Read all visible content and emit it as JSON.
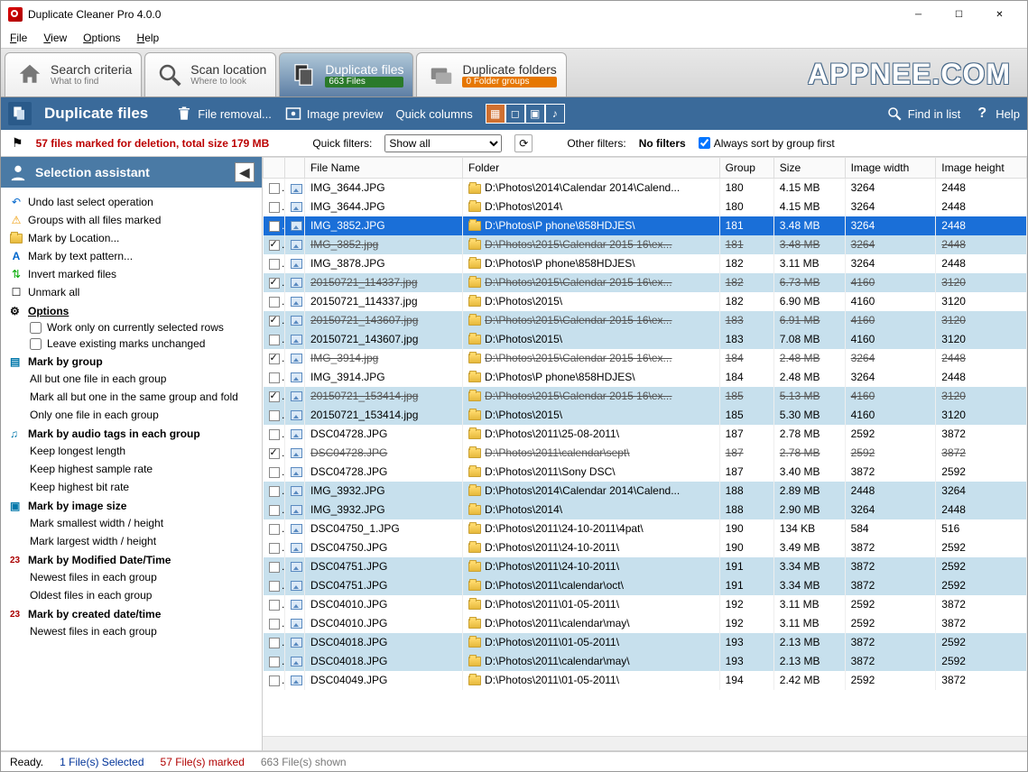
{
  "window": {
    "title": "Duplicate Cleaner Pro 4.0.0"
  },
  "menu": {
    "file": "File",
    "view": "View",
    "options": "Options",
    "help": "Help"
  },
  "tabs": {
    "search": {
      "title": "Search criteria",
      "sub": "What to find"
    },
    "scan": {
      "title": "Scan location",
      "sub": "Where to look"
    },
    "files": {
      "title": "Duplicate files",
      "badge": "663 Files"
    },
    "folders": {
      "title": "Duplicate folders",
      "badge": "0 Folder groups"
    }
  },
  "watermark": "APPNEE.COM",
  "ribbon": {
    "title": "Duplicate files",
    "fileremoval": "File removal...",
    "imagepreview": "Image preview",
    "quickcols": "Quick columns",
    "findinlist": "Find in list",
    "help": "Help"
  },
  "filterbar": {
    "marked": "57 files marked for deletion, total size 179 MB",
    "quickfilters_label": "Quick filters:",
    "quickfilters_value": "Show all",
    "otherfilters_label": "Other filters:",
    "otherfilters_value": "No filters",
    "alwayssort": "Always sort by group first"
  },
  "sidebar": {
    "title": "Selection assistant",
    "undo": "Undo last select operation",
    "groups_marked": "Groups with all files marked",
    "mark_location": "Mark by Location...",
    "mark_text": "Mark by text pattern...",
    "invert": "Invert marked files",
    "unmark": "Unmark all",
    "options": "Options",
    "opt1": "Work only on currently selected rows",
    "opt2": "Leave existing marks unchanged",
    "mark_group": "Mark by group",
    "mg1": "All but one file in each group",
    "mg2": "Mark all but one in the same group and fold",
    "mg3": "Only one file in each group",
    "mark_audio": "Mark by audio tags in each group",
    "ma1": "Keep longest length",
    "ma2": "Keep highest sample rate",
    "ma3": "Keep highest bit rate",
    "mark_image": "Mark by image size",
    "mi1": "Mark smallest width / height",
    "mi2": "Mark largest width / height",
    "mark_modified": "Mark by Modified Date/Time",
    "md1": "Newest files in each group",
    "md2": "Oldest files in each group",
    "mark_created": "Mark by created date/time",
    "mc1": "Newest files in each group"
  },
  "columns": {
    "filename": "File Name",
    "folder": "Folder",
    "group": "Group",
    "size": "Size",
    "width": "Image width",
    "height": "Image height"
  },
  "rows": [
    {
      "chk": false,
      "sel": false,
      "hl": false,
      "strike": false,
      "name": "IMG_3644.JPG",
      "folder": "D:\\Photos\\2014\\Calendar 2014\\Calend...",
      "group": "180",
      "size": "4.15 MB",
      "w": "3264",
      "h": "2448"
    },
    {
      "chk": false,
      "sel": false,
      "hl": false,
      "strike": false,
      "name": "IMG_3644.JPG",
      "folder": "D:\\Photos\\2014\\",
      "group": "180",
      "size": "4.15 MB",
      "w": "3264",
      "h": "2448"
    },
    {
      "chk": false,
      "sel": true,
      "hl": false,
      "strike": false,
      "name": "IMG_3852.JPG",
      "folder": "D:\\Photos\\P phone\\858HDJES\\",
      "group": "181",
      "size": "3.48 MB",
      "w": "3264",
      "h": "2448"
    },
    {
      "chk": true,
      "sel": false,
      "hl": true,
      "strike": true,
      "name": "IMG_3852.jpg",
      "folder": "D:\\Photos\\2015\\Calendar 2015  16\\ex...",
      "group": "181",
      "size": "3.48 MB",
      "w": "3264",
      "h": "2448"
    },
    {
      "chk": false,
      "sel": false,
      "hl": false,
      "strike": false,
      "name": "IMG_3878.JPG",
      "folder": "D:\\Photos\\P phone\\858HDJES\\",
      "group": "182",
      "size": "3.11 MB",
      "w": "3264",
      "h": "2448"
    },
    {
      "chk": true,
      "sel": false,
      "hl": true,
      "strike": true,
      "name": "20150721_114337.jpg",
      "folder": "D:\\Photos\\2015\\Calendar 2015  16\\ex...",
      "group": "182",
      "size": "6.73 MB",
      "w": "4160",
      "h": "3120"
    },
    {
      "chk": false,
      "sel": false,
      "hl": false,
      "strike": false,
      "name": "20150721_114337.jpg",
      "folder": "D:\\Photos\\2015\\",
      "group": "182",
      "size": "6.90 MB",
      "w": "4160",
      "h": "3120"
    },
    {
      "chk": true,
      "sel": false,
      "hl": true,
      "strike": true,
      "name": "20150721_143607.jpg",
      "folder": "D:\\Photos\\2015\\Calendar 2015  16\\ex...",
      "group": "183",
      "size": "6.91 MB",
      "w": "4160",
      "h": "3120"
    },
    {
      "chk": false,
      "sel": false,
      "hl": true,
      "strike": false,
      "name": "20150721_143607.jpg",
      "folder": "D:\\Photos\\2015\\",
      "group": "183",
      "size": "7.08 MB",
      "w": "4160",
      "h": "3120"
    },
    {
      "chk": true,
      "sel": false,
      "hl": false,
      "strike": true,
      "name": "IMG_3914.jpg",
      "folder": "D:\\Photos\\2015\\Calendar 2015  16\\ex...",
      "group": "184",
      "size": "2.48 MB",
      "w": "3264",
      "h": "2448"
    },
    {
      "chk": false,
      "sel": false,
      "hl": false,
      "strike": false,
      "name": "IMG_3914.JPG",
      "folder": "D:\\Photos\\P phone\\858HDJES\\",
      "group": "184",
      "size": "2.48 MB",
      "w": "3264",
      "h": "2448"
    },
    {
      "chk": true,
      "sel": false,
      "hl": true,
      "strike": true,
      "name": "20150721_153414.jpg",
      "folder": "D:\\Photos\\2015\\Calendar 2015  16\\ex...",
      "group": "185",
      "size": "5.13 MB",
      "w": "4160",
      "h": "3120"
    },
    {
      "chk": false,
      "sel": false,
      "hl": true,
      "strike": false,
      "name": "20150721_153414.jpg",
      "folder": "D:\\Photos\\2015\\",
      "group": "185",
      "size": "5.30 MB",
      "w": "4160",
      "h": "3120"
    },
    {
      "chk": false,
      "sel": false,
      "hl": false,
      "strike": false,
      "name": "DSC04728.JPG",
      "folder": "D:\\Photos\\2011\\25-08-2011\\",
      "group": "187",
      "size": "2.78 MB",
      "w": "2592",
      "h": "3872"
    },
    {
      "chk": true,
      "sel": false,
      "hl": false,
      "strike": true,
      "name": "DSC04728.JPG",
      "folder": "D:\\Photos\\2011\\calendar\\sept\\",
      "group": "187",
      "size": "2.78 MB",
      "w": "2592",
      "h": "3872"
    },
    {
      "chk": false,
      "sel": false,
      "hl": false,
      "strike": false,
      "name": "DSC04728.JPG",
      "folder": "D:\\Photos\\2011\\Sony DSC\\",
      "group": "187",
      "size": "3.40 MB",
      "w": "3872",
      "h": "2592"
    },
    {
      "chk": false,
      "sel": false,
      "hl": true,
      "strike": false,
      "name": "IMG_3932.JPG",
      "folder": "D:\\Photos\\2014\\Calendar 2014\\Calend...",
      "group": "188",
      "size": "2.89 MB",
      "w": "2448",
      "h": "3264"
    },
    {
      "chk": false,
      "sel": false,
      "hl": true,
      "strike": false,
      "name": "IMG_3932.JPG",
      "folder": "D:\\Photos\\2014\\",
      "group": "188",
      "size": "2.90 MB",
      "w": "3264",
      "h": "2448"
    },
    {
      "chk": false,
      "sel": false,
      "hl": false,
      "strike": false,
      "name": "DSC04750_1.JPG",
      "folder": "D:\\Photos\\2011\\24-10-2011\\4pat\\",
      "group": "190",
      "size": "134 KB",
      "w": "584",
      "h": "516"
    },
    {
      "chk": false,
      "sel": false,
      "hl": false,
      "strike": false,
      "name": "DSC04750.JPG",
      "folder": "D:\\Photos\\2011\\24-10-2011\\",
      "group": "190",
      "size": "3.49 MB",
      "w": "3872",
      "h": "2592"
    },
    {
      "chk": false,
      "sel": false,
      "hl": true,
      "strike": false,
      "name": "DSC04751.JPG",
      "folder": "D:\\Photos\\2011\\24-10-2011\\",
      "group": "191",
      "size": "3.34 MB",
      "w": "3872",
      "h": "2592"
    },
    {
      "chk": false,
      "sel": false,
      "hl": true,
      "strike": false,
      "name": "DSC04751.JPG",
      "folder": "D:\\Photos\\2011\\calendar\\oct\\",
      "group": "191",
      "size": "3.34 MB",
      "w": "3872",
      "h": "2592"
    },
    {
      "chk": false,
      "sel": false,
      "hl": false,
      "strike": false,
      "name": "DSC04010.JPG",
      "folder": "D:\\Photos\\2011\\01-05-2011\\",
      "group": "192",
      "size": "3.11 MB",
      "w": "2592",
      "h": "3872"
    },
    {
      "chk": false,
      "sel": false,
      "hl": false,
      "strike": false,
      "name": "DSC04010.JPG",
      "folder": "D:\\Photos\\2011\\calendar\\may\\",
      "group": "192",
      "size": "3.11 MB",
      "w": "2592",
      "h": "3872"
    },
    {
      "chk": false,
      "sel": false,
      "hl": true,
      "strike": false,
      "name": "DSC04018.JPG",
      "folder": "D:\\Photos\\2011\\01-05-2011\\",
      "group": "193",
      "size": "2.13 MB",
      "w": "3872",
      "h": "2592"
    },
    {
      "chk": false,
      "sel": false,
      "hl": true,
      "strike": false,
      "name": "DSC04018.JPG",
      "folder": "D:\\Photos\\2011\\calendar\\may\\",
      "group": "193",
      "size": "2.13 MB",
      "w": "3872",
      "h": "2592"
    },
    {
      "chk": false,
      "sel": false,
      "hl": false,
      "strike": false,
      "name": "DSC04049.JPG",
      "folder": "D:\\Photos\\2011\\01-05-2011\\",
      "group": "194",
      "size": "2.42 MB",
      "w": "2592",
      "h": "3872"
    }
  ],
  "status": {
    "ready": "Ready.",
    "selected": "1 File(s) Selected",
    "marked": "57 File(s) marked",
    "shown": "663 File(s) shown"
  }
}
